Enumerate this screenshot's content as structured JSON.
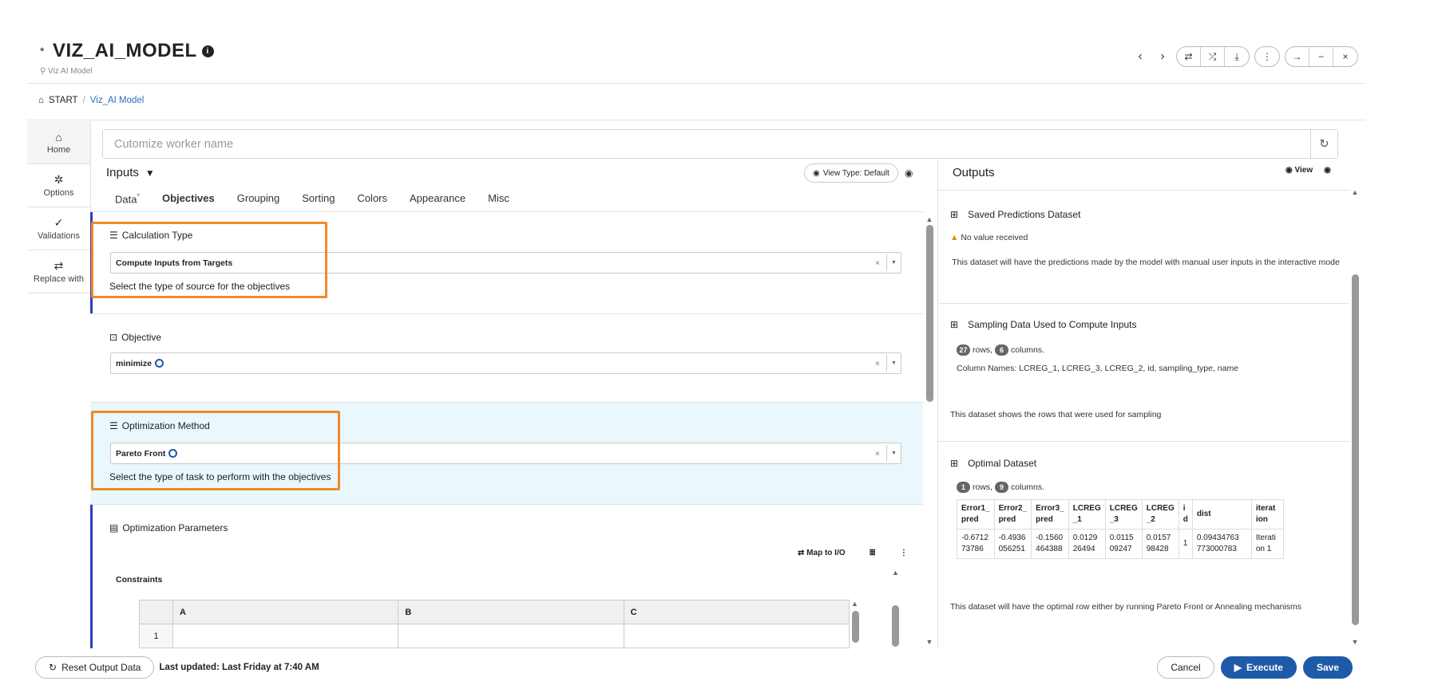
{
  "header": {
    "title": "VIZ_AI_MODEL",
    "modified_mark": "*",
    "subtitle": "Viz AI Model"
  },
  "breadcrumb": {
    "home": "START",
    "separator": "/",
    "current": "Viz_AI Model"
  },
  "sidenav": [
    {
      "label": "Home",
      "icon": "home-icon"
    },
    {
      "label": "Options",
      "icon": "gear-icon"
    },
    {
      "label": "Validations",
      "icon": "check-double-icon"
    },
    {
      "label": "Replace with",
      "icon": "swap-icon"
    }
  ],
  "worker": {
    "placeholder": "Cutomize worker name"
  },
  "inputs": {
    "title": "Inputs",
    "view_type": "View Type: Default",
    "tabs": [
      "Data",
      "Objectives",
      "Grouping",
      "Sorting",
      "Colors",
      "Appearance",
      "Misc"
    ],
    "calc_type": {
      "label": "Calculation Type",
      "value": "Compute Inputs from Targets",
      "help": "Select the type of source for the objectives"
    },
    "objective": {
      "label": "Objective",
      "value": "minimize"
    },
    "opt_method": {
      "label": "Optimization Method",
      "value": "Pareto Front",
      "help": "Select the type of task to perform with the objectives"
    },
    "opt_params": {
      "label": "Optimization Parameters",
      "map_label": "Map to I/O",
      "constraints": "Constraints",
      "columns": [
        "A",
        "B",
        "C"
      ],
      "row1": "1"
    }
  },
  "outputs": {
    "title": "Outputs",
    "view": "View",
    "saved": {
      "title": "Saved Predictions Dataset",
      "warn": "No value received",
      "desc": "This dataset will have the predictions made by the model with manual user inputs in the interactive mode"
    },
    "sampling": {
      "title": "Sampling Data Used to Compute Inputs",
      "rows": "27",
      "rows_label": "rows,",
      "cols": "6",
      "cols_label": "columns.",
      "colnames": "Column Names: LCREG_1, LCREG_3, LCREG_2, id, sampling_type, name",
      "desc": "This dataset shows the rows that were used for sampling"
    },
    "optimal": {
      "title": "Optimal Dataset",
      "rows": "1",
      "rows_label": "rows,",
      "cols": "9",
      "cols_label": "columns.",
      "headers": [
        "Error1_ pred",
        "Error2_ pred",
        "Error3_ pred",
        "LCREG _1",
        "LCREG _3",
        "LCREG _2",
        "i d",
        "dist",
        "iterat ion"
      ],
      "values": [
        "-0.6712 73786",
        "-0.4936 056251",
        "-0.1560 464388",
        "0.0129 26494",
        "0.0115 09247",
        "0.0157 98428",
        "1",
        "0.09434763 773000783",
        "Iterati on 1"
      ],
      "desc": "This dataset will have the optimal row either by running Pareto Front or Annealing mechanisms"
    }
  },
  "footer": {
    "reset": "Reset Output Data",
    "updated": "Last updated: Last Friday at 7:40 AM",
    "cancel": "Cancel",
    "execute": "Execute",
    "save": "Save"
  }
}
